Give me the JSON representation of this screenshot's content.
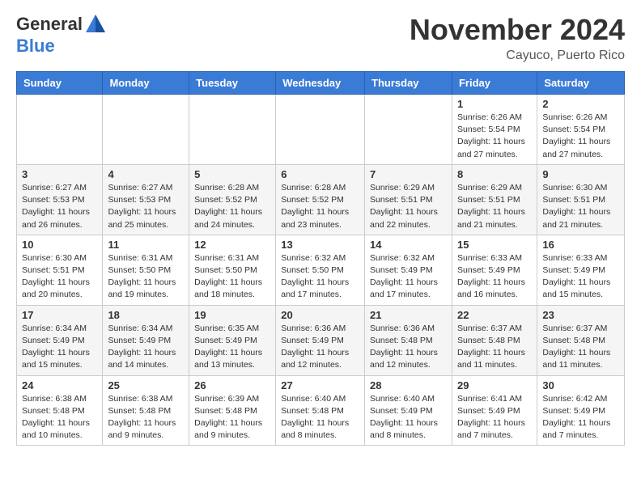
{
  "header": {
    "logo_general": "General",
    "logo_blue": "Blue",
    "month_title": "November 2024",
    "location": "Cayuco, Puerto Rico"
  },
  "days_of_week": [
    "Sunday",
    "Monday",
    "Tuesday",
    "Wednesday",
    "Thursday",
    "Friday",
    "Saturday"
  ],
  "weeks": [
    [
      {
        "day": "",
        "info": ""
      },
      {
        "day": "",
        "info": ""
      },
      {
        "day": "",
        "info": ""
      },
      {
        "day": "",
        "info": ""
      },
      {
        "day": "",
        "info": ""
      },
      {
        "day": "1",
        "info": "Sunrise: 6:26 AM\nSunset: 5:54 PM\nDaylight: 11 hours and 27 minutes."
      },
      {
        "day": "2",
        "info": "Sunrise: 6:26 AM\nSunset: 5:54 PM\nDaylight: 11 hours and 27 minutes."
      }
    ],
    [
      {
        "day": "3",
        "info": "Sunrise: 6:27 AM\nSunset: 5:53 PM\nDaylight: 11 hours and 26 minutes."
      },
      {
        "day": "4",
        "info": "Sunrise: 6:27 AM\nSunset: 5:53 PM\nDaylight: 11 hours and 25 minutes."
      },
      {
        "day": "5",
        "info": "Sunrise: 6:28 AM\nSunset: 5:52 PM\nDaylight: 11 hours and 24 minutes."
      },
      {
        "day": "6",
        "info": "Sunrise: 6:28 AM\nSunset: 5:52 PM\nDaylight: 11 hours and 23 minutes."
      },
      {
        "day": "7",
        "info": "Sunrise: 6:29 AM\nSunset: 5:51 PM\nDaylight: 11 hours and 22 minutes."
      },
      {
        "day": "8",
        "info": "Sunrise: 6:29 AM\nSunset: 5:51 PM\nDaylight: 11 hours and 21 minutes."
      },
      {
        "day": "9",
        "info": "Sunrise: 6:30 AM\nSunset: 5:51 PM\nDaylight: 11 hours and 21 minutes."
      }
    ],
    [
      {
        "day": "10",
        "info": "Sunrise: 6:30 AM\nSunset: 5:51 PM\nDaylight: 11 hours and 20 minutes."
      },
      {
        "day": "11",
        "info": "Sunrise: 6:31 AM\nSunset: 5:50 PM\nDaylight: 11 hours and 19 minutes."
      },
      {
        "day": "12",
        "info": "Sunrise: 6:31 AM\nSunset: 5:50 PM\nDaylight: 11 hours and 18 minutes."
      },
      {
        "day": "13",
        "info": "Sunrise: 6:32 AM\nSunset: 5:50 PM\nDaylight: 11 hours and 17 minutes."
      },
      {
        "day": "14",
        "info": "Sunrise: 6:32 AM\nSunset: 5:49 PM\nDaylight: 11 hours and 17 minutes."
      },
      {
        "day": "15",
        "info": "Sunrise: 6:33 AM\nSunset: 5:49 PM\nDaylight: 11 hours and 16 minutes."
      },
      {
        "day": "16",
        "info": "Sunrise: 6:33 AM\nSunset: 5:49 PM\nDaylight: 11 hours and 15 minutes."
      }
    ],
    [
      {
        "day": "17",
        "info": "Sunrise: 6:34 AM\nSunset: 5:49 PM\nDaylight: 11 hours and 15 minutes."
      },
      {
        "day": "18",
        "info": "Sunrise: 6:34 AM\nSunset: 5:49 PM\nDaylight: 11 hours and 14 minutes."
      },
      {
        "day": "19",
        "info": "Sunrise: 6:35 AM\nSunset: 5:49 PM\nDaylight: 11 hours and 13 minutes."
      },
      {
        "day": "20",
        "info": "Sunrise: 6:36 AM\nSunset: 5:49 PM\nDaylight: 11 hours and 12 minutes."
      },
      {
        "day": "21",
        "info": "Sunrise: 6:36 AM\nSunset: 5:48 PM\nDaylight: 11 hours and 12 minutes."
      },
      {
        "day": "22",
        "info": "Sunrise: 6:37 AM\nSunset: 5:48 PM\nDaylight: 11 hours and 11 minutes."
      },
      {
        "day": "23",
        "info": "Sunrise: 6:37 AM\nSunset: 5:48 PM\nDaylight: 11 hours and 11 minutes."
      }
    ],
    [
      {
        "day": "24",
        "info": "Sunrise: 6:38 AM\nSunset: 5:48 PM\nDaylight: 11 hours and 10 minutes."
      },
      {
        "day": "25",
        "info": "Sunrise: 6:38 AM\nSunset: 5:48 PM\nDaylight: 11 hours and 9 minutes."
      },
      {
        "day": "26",
        "info": "Sunrise: 6:39 AM\nSunset: 5:48 PM\nDaylight: 11 hours and 9 minutes."
      },
      {
        "day": "27",
        "info": "Sunrise: 6:40 AM\nSunset: 5:48 PM\nDaylight: 11 hours and 8 minutes."
      },
      {
        "day": "28",
        "info": "Sunrise: 6:40 AM\nSunset: 5:49 PM\nDaylight: 11 hours and 8 minutes."
      },
      {
        "day": "29",
        "info": "Sunrise: 6:41 AM\nSunset: 5:49 PM\nDaylight: 11 hours and 7 minutes."
      },
      {
        "day": "30",
        "info": "Sunrise: 6:42 AM\nSunset: 5:49 PM\nDaylight: 11 hours and 7 minutes."
      }
    ]
  ]
}
